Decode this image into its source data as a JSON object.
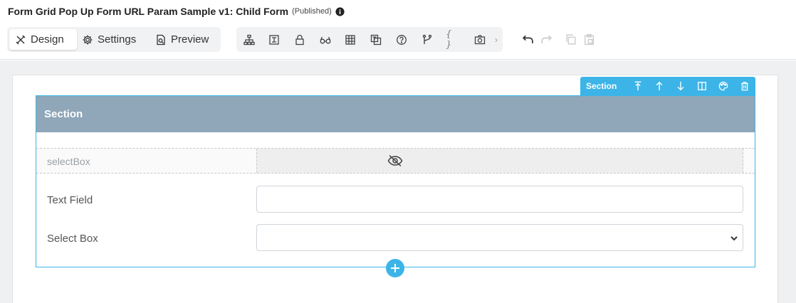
{
  "header": {
    "title": "Form Grid Pop Up Form URL Param Sample v1: Child Form",
    "status": "(Published)",
    "info_icon": "info-icon"
  },
  "modes": {
    "design": "Design",
    "settings": "Settings",
    "preview": "Preview",
    "active": "design"
  },
  "toolbar": {
    "icons": [
      "hierarchy-icon",
      "field-list-icon",
      "lock-icon",
      "glasses-icon",
      "grid-icon",
      "translate-icon",
      "help-icon",
      "branch-icon",
      "braces-icon",
      "camera-icon",
      "chevron-right-icon"
    ],
    "braces_glyph": "{ }",
    "more_glyph": "›"
  },
  "history": {
    "icons": [
      "undo-icon",
      "redo-icon",
      "copy-icon",
      "paste-icon"
    ]
  },
  "section_toolbar": {
    "label": "Section",
    "icons": [
      "move-top-icon",
      "move-up-icon",
      "move-down-icon",
      "columns-icon",
      "palette-icon",
      "trash-icon"
    ]
  },
  "section": {
    "title": "Section",
    "fields": [
      {
        "label": "selectBox",
        "hidden": true
      },
      {
        "label": "Text Field",
        "value": ""
      },
      {
        "label": "Select Box",
        "value": ""
      }
    ]
  },
  "colors": {
    "accent": "#3cb4e8",
    "section_header": "#8fa7b9",
    "canvas_bg": "#eef0f2"
  }
}
